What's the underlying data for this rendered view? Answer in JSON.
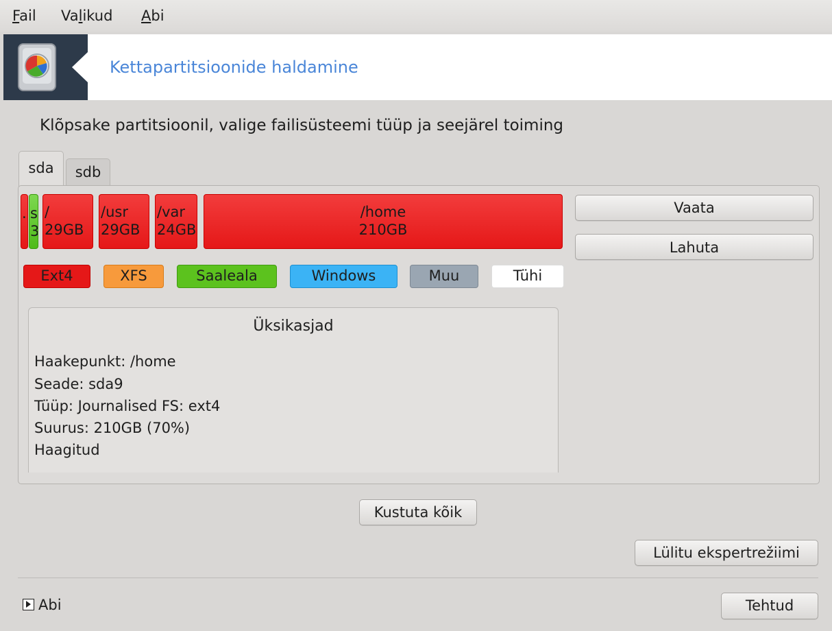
{
  "menu": {
    "file": {
      "accel": "F",
      "rest": "ail"
    },
    "options": {
      "pre": "Va",
      "accel": "l",
      "rest": "ikud"
    },
    "help": {
      "accel": "A",
      "rest": "bi"
    }
  },
  "banner": {
    "title": "Kettapartitsioonide haldamine",
    "icon": "hard-disk-pie-icon"
  },
  "instruction": "Klõpsake partitsioonil, valige failisüsteemi tüüp ja seejärel toiming",
  "tabs": [
    {
      "label": "sda"
    },
    {
      "label": "sdb"
    }
  ],
  "partitions": [
    {
      "line1": ".",
      "line2": "",
      "color": "#e51818"
    },
    {
      "line1": "s",
      "line2": "3",
      "color": "#4fbb1a"
    },
    {
      "line1": "/",
      "line2": "29GB",
      "color": "#e51818"
    },
    {
      "line1": "/usr",
      "line2": "29GB",
      "color": "#e51818"
    },
    {
      "line1": "/var",
      "line2": "24GB",
      "color": "#e51818"
    },
    {
      "line1": "/home",
      "line2": "210GB",
      "color": "#e51818"
    }
  ],
  "actions": {
    "view": "Vaata",
    "unmount": "Lahuta"
  },
  "legend": {
    "ext4": {
      "label": "Ext4",
      "color": "#e51818"
    },
    "xfs": {
      "label": "XFS",
      "color": "#f79a3c"
    },
    "swap": {
      "label": "Saaleala",
      "color": "#5cc21e"
    },
    "windows": {
      "label": "Windows",
      "color": "#3bb3f5"
    },
    "other": {
      "label": "Muu",
      "color": "#9aa6b2"
    },
    "empty": {
      "label": "Tühi",
      "color": "#ffffff"
    }
  },
  "details": {
    "title": "Üksikasjad",
    "mount_point": "Haakepunkt: /home",
    "device": "Seade: sda9",
    "type": "Tüüp: Journalised FS: ext4",
    "size": "Suurus: 210GB (70%)",
    "status": "Haagitud"
  },
  "buttons": {
    "clear_all": "Kustuta kõik",
    "expert_mode": "Lülitu ekspertrežiimi",
    "done": "Tehtud"
  },
  "help": {
    "label": "Abi"
  }
}
